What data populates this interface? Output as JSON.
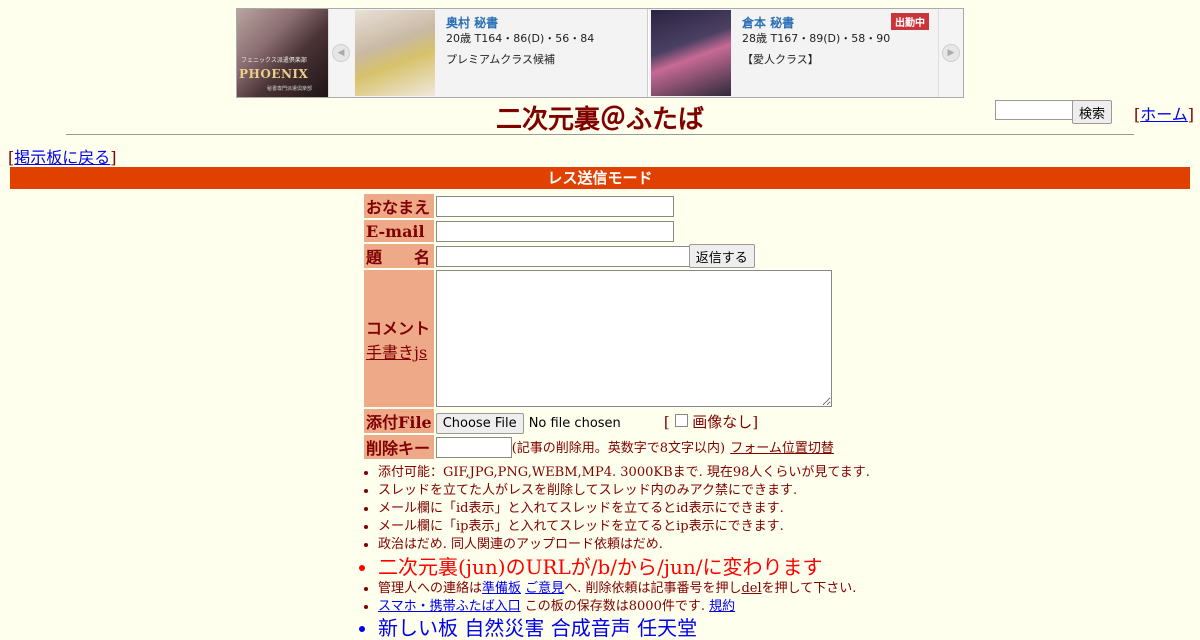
{
  "ad": {
    "banner_logo": "PHOENIX",
    "banner_small": "フェニックス派遣倶楽部",
    "banner_tiny": "秘書専門派遣倶楽部",
    "left_arrow": "◀",
    "right_arrow": "▶",
    "cards": [
      {
        "name": "奥村 秘書",
        "stats": "20歳 T164・86(D)・56・84",
        "desc": "プレミアムクラス候補",
        "badge": ""
      },
      {
        "name": "倉本 秘書",
        "stats": "28歳 T167・89(D)・58・90",
        "desc": "【愛人クラス】",
        "badge": "出勤中"
      }
    ]
  },
  "header": {
    "title": "二次元裏＠ふたば",
    "search_button": "検索",
    "home_link": "ホーム"
  },
  "nav": {
    "back_link": "掲示板に戻る"
  },
  "mode_bar": "レス送信モード",
  "form": {
    "name_label": "おなまえ",
    "email_label": "E-mail",
    "subject_label": "題　　名",
    "submit_button": "返信する",
    "comment_label": "コメント",
    "handwrite_link": "手書きjs",
    "file_label": "添付File",
    "file_button": "Choose File",
    "file_status": "No file chosen",
    "no_image_label": "画像なし",
    "delkey_label": "削除キー",
    "delkey_note": "(記事の削除用。英数字で8文字以内)",
    "form_position_link": "フォーム位置切替"
  },
  "notes": {
    "n1": "添付可能：GIF,JPG,PNG,WEBM,MP4. 3000KBまで. 現在98人くらいが見てます.",
    "n2": "スレッドを立てた人がレスを削除してスレッド内のみアク禁にできます.",
    "n3": "メール欄に「id表示」と入れてスレッドを立てるとid表示にできます.",
    "n4": "メール欄に「ip表示」と入れてスレッドを立てるとip表示にできます.",
    "n5": "政治はだめ. 同人関連のアップロード依頼はだめ.",
    "n6": "二次元裏(jun)のURLが/b/から/jun/に変わります",
    "n7_a": "管理人への連絡は",
    "n7_link1": "準備板",
    "n7_link2": "ご意見",
    "n7_b": "へ. 削除依頼は記事番号を押し",
    "n7_link3": "del",
    "n7_c": "を押して下さい.",
    "n8_link1": "スマホ・携帯ふたば入口",
    "n8_b": "この板の保存数は8000件です.",
    "n8_link2": "規約",
    "n9": "新しい板 自然災害 合成音声 任天堂"
  }
}
